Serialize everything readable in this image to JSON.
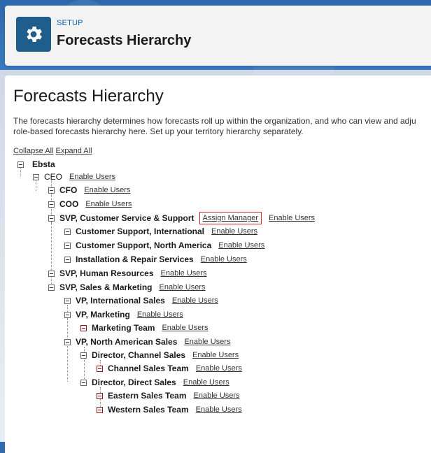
{
  "header": {
    "setup_label": "SETUP",
    "title": "Forecasts Hierarchy"
  },
  "main": {
    "title": "Forecasts Hierarchy",
    "description_line1": "The forecasts hierarchy determines how forecasts roll up within the organization, and who can view and adju",
    "description_line2": "role-based forecasts hierarchy here. Set up your territory hierarchy separately.",
    "collapse_all": "Collapse All",
    "expand_all": "Expand All"
  },
  "tree": {
    "enable_users": "Enable Users",
    "assign_manager": "Assign Manager",
    "nodes": [
      {
        "label": "Ebsta"
      },
      {
        "label": "CEO"
      },
      {
        "label": "CFO"
      },
      {
        "label": "COO"
      },
      {
        "label": "SVP, Customer Service & Support"
      },
      {
        "label": "Customer Support, International"
      },
      {
        "label": "Customer Support, North America"
      },
      {
        "label": "Installation & Repair Services"
      },
      {
        "label": "SVP, Human Resources"
      },
      {
        "label": "SVP, Sales & Marketing"
      },
      {
        "label": "VP, International Sales"
      },
      {
        "label": "VP, Marketing"
      },
      {
        "label": "Marketing Team"
      },
      {
        "label": "VP, North American Sales"
      },
      {
        "label": "Director, Channel Sales"
      },
      {
        "label": "Channel Sales Team"
      },
      {
        "label": "Director, Direct Sales"
      },
      {
        "label": "Eastern Sales Team"
      },
      {
        "label": "Western Sales Team"
      }
    ]
  },
  "colors": {
    "accent": "#1f5d8d",
    "link": "#0a64a4",
    "highlight_border": "#d62a2a"
  },
  "icons": {
    "header_icon": "gear-icon",
    "tree_toggle": "collapse-toggle-icon"
  }
}
